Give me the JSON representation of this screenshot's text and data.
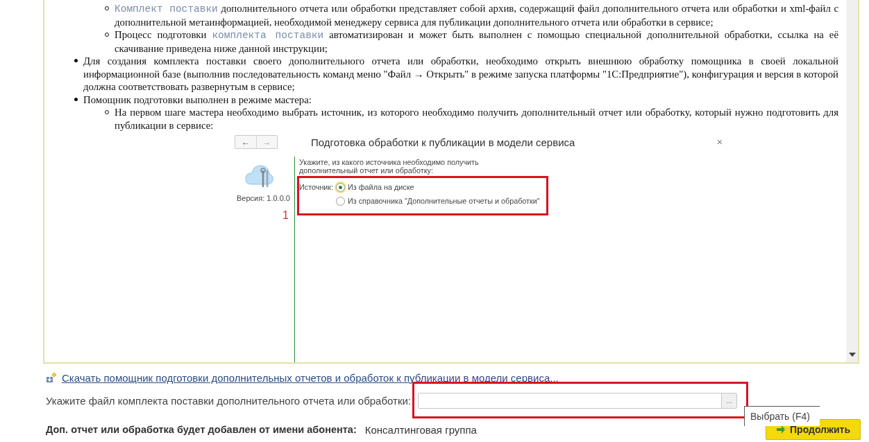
{
  "document": {
    "items": [
      {
        "children": [
          {
            "segments": [
              {
                "kind": "term",
                "text": "Комплект поставки"
              },
              {
                "kind": "plain",
                "text": " дополнительного отчета или обработки представляет собой архив, содержащий файл дополнительного отчета или обработки и xml-файл с дополнительной метаинформацией, необходимой менеджеру сервиса для публикации дополнительного отчета или обработки в сервисе;"
              }
            ]
          },
          {
            "segments": [
              {
                "kind": "plain",
                "text": "Процесс подготовки "
              },
              {
                "kind": "term",
                "text": "комплекта поставки"
              },
              {
                "kind": "plain",
                "text": " автоматизирован и может быть выполнен с помощью специальной дополнительной обработки, ссылка на её скачивание приведена ниже данной инструкции;"
              }
            ]
          }
        ]
      },
      {
        "segments": [
          {
            "kind": "plain",
            "text": "Для создания комплекта поставки своего дополнительного отчета или обработки, необходимо открыть внешнюю обработку помощника в своей локальной информационной базе (выполнив последовательность команд меню \"Файл → Открыть\" в режиме запуска платформы \"1С:Предприятие\"), конфигурация и версия в которой должна соответствовать развернутым в сервисе;"
          }
        ]
      },
      {
        "segments": [
          {
            "kind": "plain",
            "text": "Помощник подготовки выполнен в режиме мастера:"
          }
        ],
        "children": [
          {
            "segments": [
              {
                "kind": "plain",
                "text": "На первом шаге мастера необходимо выбрать источник, из которого необходимо получить дополнительный отчет или обработку, который нужно подготовить для публикации в сервисе:"
              }
            ]
          }
        ]
      }
    ],
    "wizard": {
      "back": "←",
      "forward": "→",
      "title": "Подготовка обработки к публикации в модели сервиса",
      "close": "×",
      "version": "Версия: 1.0.0.0",
      "step_marker": "1",
      "prompt": "Укажите, из какого источника необходимо получить дополнительный отчет или обработку:",
      "source_label": "Источник:",
      "options": [
        {
          "label": "Из файла на диске",
          "selected": true
        },
        {
          "label": "Из справочника \"Дополнительные отчеты и обработки\"",
          "selected": false
        }
      ]
    }
  },
  "download_link": "Скачать помощник подготовки дополнительных отчетов и обработок к публикации в модели сервиса...",
  "file_field": {
    "label": "Укажите файл комплекта поставки дополнительного отчета или обработки:",
    "choose_button": "...",
    "tooltip": "Выбрать (F4)"
  },
  "subscriber": {
    "label": "Доп. отчет или обработка будет добавлен от имени абонента:",
    "value": "Консалтинговая группа"
  },
  "continue_button": "Продолжить"
}
